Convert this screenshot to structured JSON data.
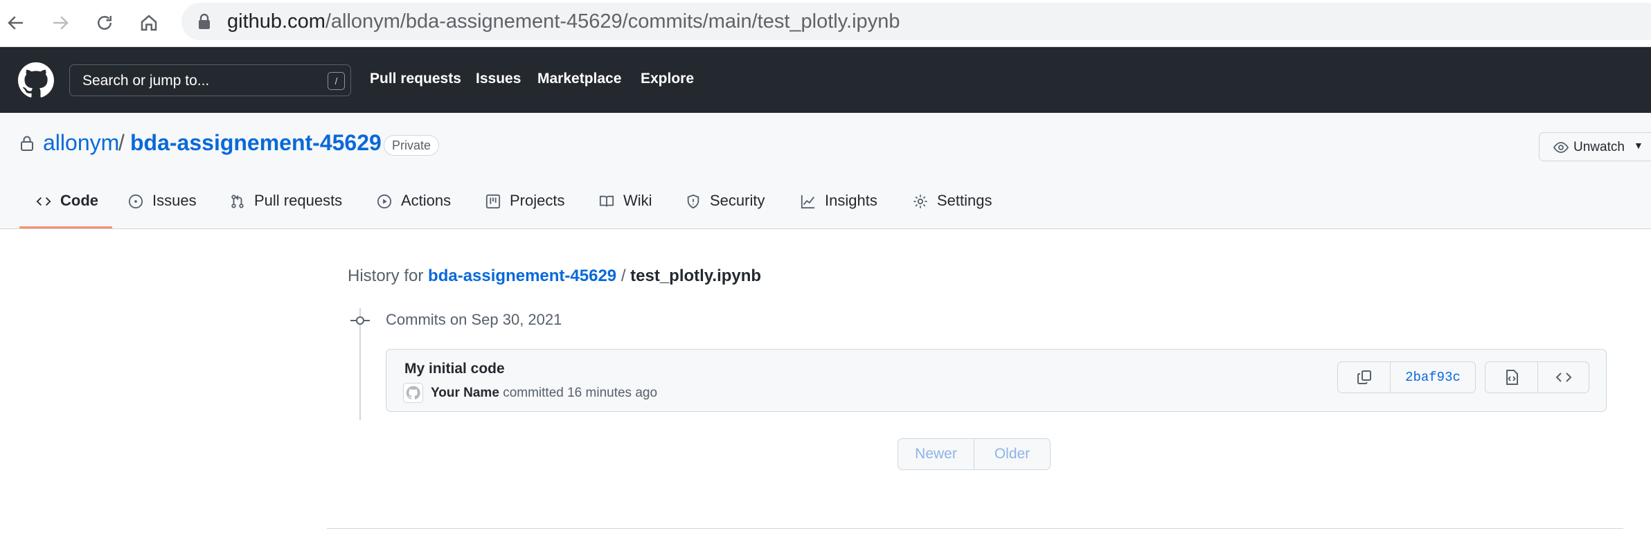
{
  "browser": {
    "url_host": "github.com",
    "url_path": "/allonym/bda-assignement-45629/commits/main/test_plotly.ipynb",
    "icons": [
      "back-arrow-icon",
      "forward-arrow-icon",
      "reload-icon",
      "home-icon",
      "lock-icon"
    ]
  },
  "header": {
    "search_placeholder": "Search or jump to...",
    "search_shortcut": "/",
    "nav": [
      "Pull requests",
      "Issues",
      "Marketplace",
      "Explore"
    ]
  },
  "repo": {
    "owner": "allonym",
    "separator": "/",
    "name": "bda-assignement-45629",
    "visibility": "Private",
    "watch_label": "Unwatch",
    "tabs": [
      {
        "label": "Code",
        "icon": "code-icon",
        "active": true
      },
      {
        "label": "Issues",
        "icon": "issue-icon"
      },
      {
        "label": "Pull requests",
        "icon": "pull-request-icon"
      },
      {
        "label": "Actions",
        "icon": "actions-icon"
      },
      {
        "label": "Projects",
        "icon": "projects-icon"
      },
      {
        "label": "Wiki",
        "icon": "wiki-icon"
      },
      {
        "label": "Security",
        "icon": "shield-icon"
      },
      {
        "label": "Insights",
        "icon": "graph-icon"
      },
      {
        "label": "Settings",
        "icon": "gear-icon"
      }
    ]
  },
  "history": {
    "prefix": "History for",
    "repo_link": "bda-assignement-45629",
    "separator": "/",
    "file": "test_plotly.ipynb",
    "date_heading": "Commits on Sep 30, 2021",
    "commits": [
      {
        "message": "My initial code",
        "author": "Your Name",
        "action": "committed",
        "time": "16 minutes ago",
        "sha": "2baf93c"
      }
    ],
    "pager": {
      "newer": "Newer",
      "older": "Older"
    }
  },
  "colors": {
    "accent": "#0969da",
    "header_bg": "#24292f",
    "tab_underline": "#fd8c73"
  }
}
